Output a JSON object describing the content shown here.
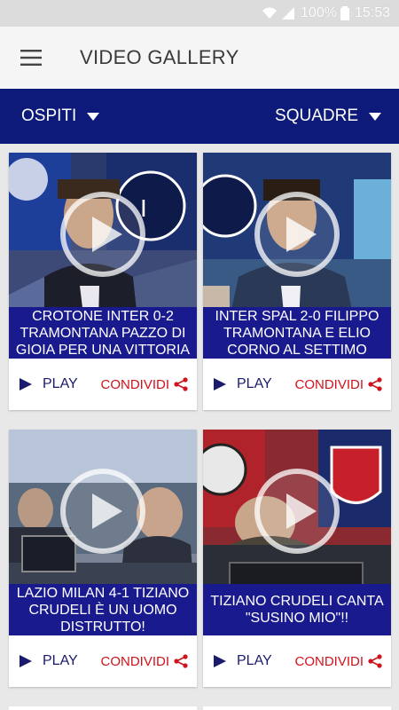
{
  "status_bar": {
    "battery": "100%",
    "time": "15:53"
  },
  "app_bar": {
    "title": "VIDEO GALLERY",
    "menu_icon": "hamburger-menu-icon"
  },
  "filters": {
    "left_label": "OSPITI",
    "right_label": "SQUADRE"
  },
  "colors": {
    "filter_bar": "#0d1a7a",
    "caption_bg": "#1a1a8f",
    "play_text": "#1a1a6e",
    "share_text": "#d0121b"
  },
  "videos": [
    {
      "caption": "CROTONE INTER 0-2 TRAMONTANA PAZZO DI GIOIA PER UNA VITTORIA",
      "play_label": "PLAY",
      "share_label": "CONDIVIDI"
    },
    {
      "caption": "INTER SPAL 2-0 FILIPPO TRAMONTANA E ELIO CORNO AL SETTIMO",
      "play_label": "PLAY",
      "share_label": "CONDIVIDI"
    },
    {
      "caption": "LAZIO MILAN 4-1 TIZIANO CRUDELI È UN UOMO DISTRUTTO!",
      "play_label": "PLAY",
      "share_label": "CONDIVIDI"
    },
    {
      "caption": "TIZIANO CRUDELI CANTA \"SUSINO MIO\"!!",
      "play_label": "PLAY",
      "share_label": "CONDIVIDI"
    }
  ]
}
